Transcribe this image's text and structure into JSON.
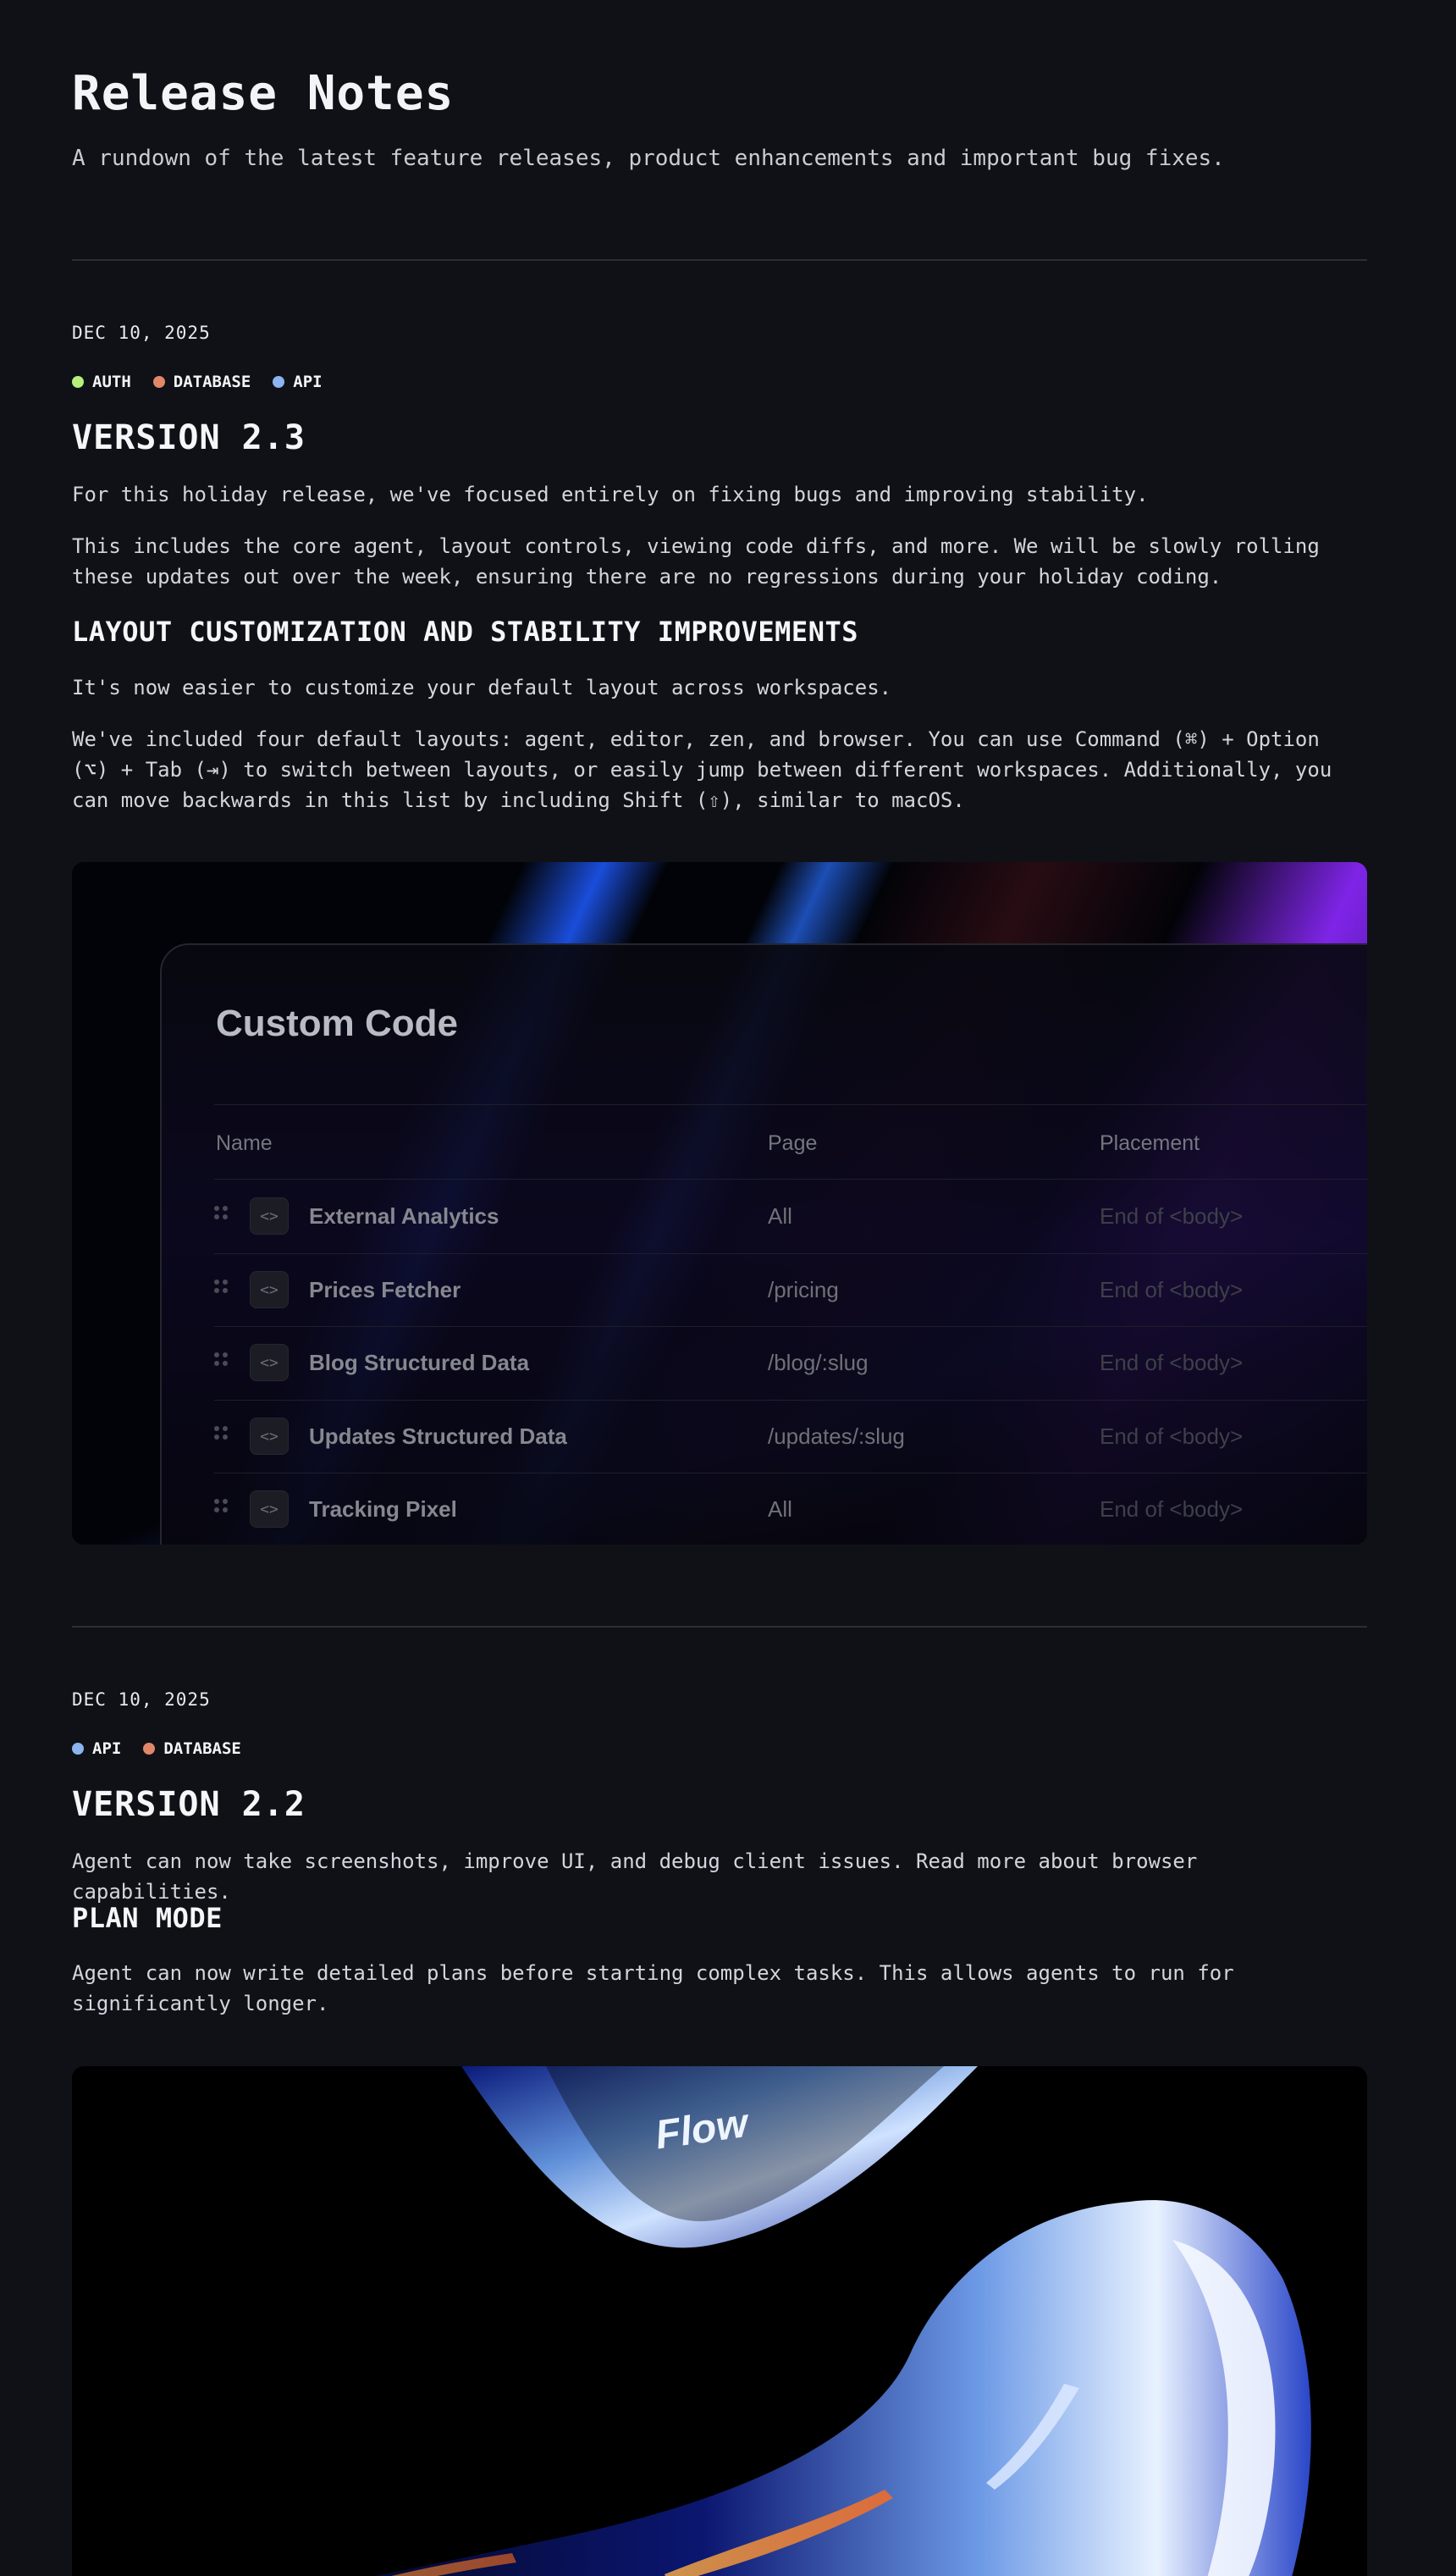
{
  "header": {
    "title": "Release Notes",
    "subtitle": "A rundown of the latest feature releases, product enhancements and important bug fixes."
  },
  "releases": [
    {
      "date": "DEC 10, 2025",
      "tags": [
        {
          "label": "AUTH",
          "color": "#b6f07a"
        },
        {
          "label": "DATABASE",
          "color": "#e0876a"
        },
        {
          "label": "API",
          "color": "#8bb4f0"
        }
      ],
      "version": "VERSION 2.3",
      "intro": [
        "For this holiday release, we've focused entirely on fixing bugs and improving stability.",
        "This includes the core agent, layout controls, viewing code diffs, and more. We will be slowly rolling these updates out over the week, ensuring there are no regressions during your holiday coding."
      ],
      "section_title": "LAYOUT CUSTOMIZATION AND STABILITY IMPROVEMENTS",
      "section_body": [
        "It's now easier to customize your default layout across workspaces.",
        "We've included four default layouts: agent, editor, zen, and browser. You can use Command (⌘) + Option (⌥) + Tab (⇥) to switch between layouts, or easily jump between different workspaces. Additionally, you can move backwards in this list by including Shift (⇧), similar to macOS."
      ],
      "media": {
        "title": "Custom Code",
        "columns": [
          "Name",
          "Page",
          "Placement"
        ],
        "rows": [
          {
            "name": "External Analytics",
            "page": "All",
            "placement": "End of <body>"
          },
          {
            "name": "Prices Fetcher",
            "page": "/pricing",
            "placement": "End of <body>"
          },
          {
            "name": "Blog Structured Data",
            "page": "/blog/:slug",
            "placement": "End of <body>"
          },
          {
            "name": "Updates Structured Data",
            "page": "/updates/:slug",
            "placement": "End of <body>"
          },
          {
            "name": "Tracking Pixel",
            "page": "All",
            "placement": "End of <body>"
          }
        ]
      }
    },
    {
      "date": "DEC 10, 2025",
      "tags": [
        {
          "label": "API",
          "color": "#8bb4f0"
        },
        {
          "label": "DATABASE",
          "color": "#e0876a"
        }
      ],
      "version": "VERSION 2.2",
      "intro": [
        "Agent can now take screenshots, improve UI, and debug client issues. Read more about browser capabilities."
      ],
      "section_title": "PLAN MODE",
      "section_body": [
        "Agent can now write detailed plans before starting complex tasks. This allows agents to run for significantly longer."
      ],
      "media": {
        "logo_text": "Flow"
      }
    }
  ]
}
